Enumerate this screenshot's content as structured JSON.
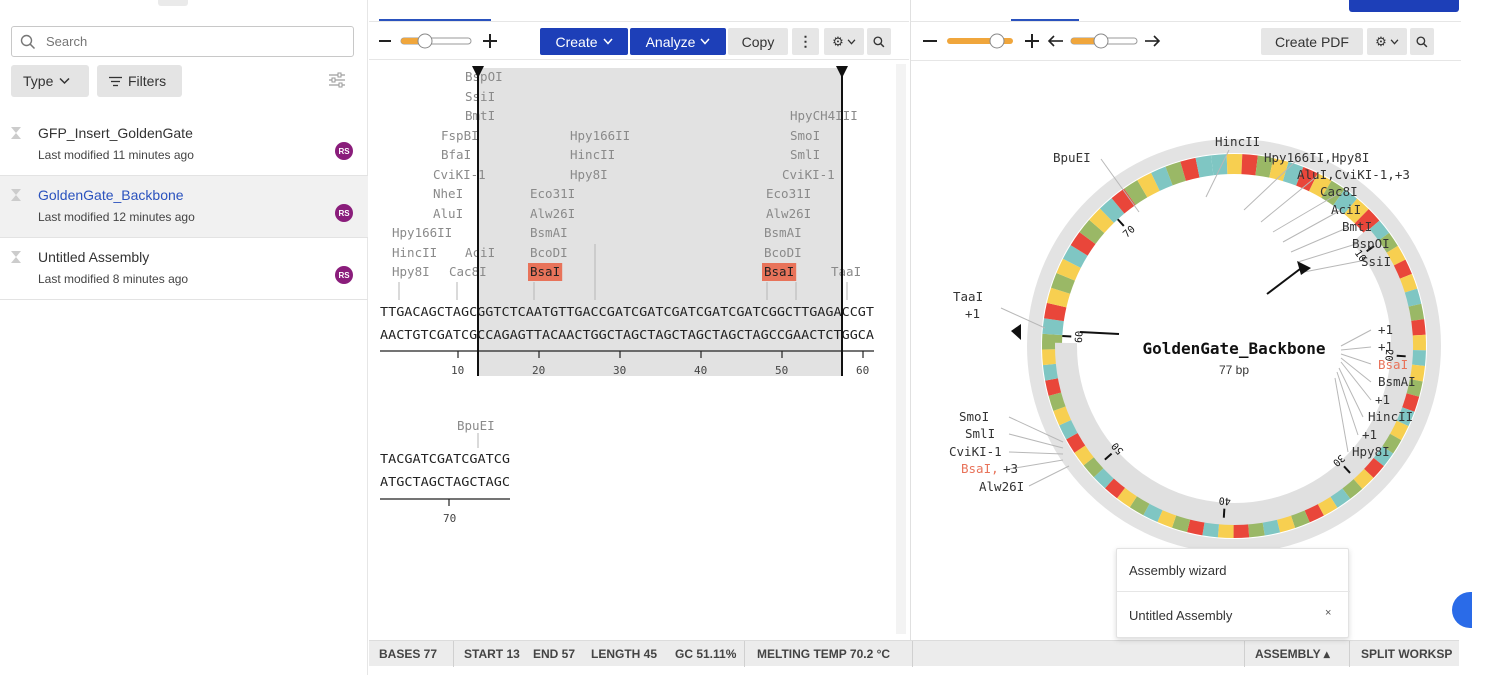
{
  "sidebar": {
    "search_placeholder": "Search",
    "type_label": "Type",
    "filters_label": "Filters",
    "files": [
      {
        "name": "GFP_Insert_GoldenGate",
        "meta": "Last modified 11 minutes ago",
        "avatar": "RS"
      },
      {
        "name": "GoldenGate_Backbone",
        "meta": "Last modified 12 minutes ago",
        "avatar": "RS"
      },
      {
        "name": "Untitled Assembly",
        "meta": "Last modified 8 minutes ago",
        "avatar": "RS"
      }
    ]
  },
  "seq_toolbar": {
    "create_label": "Create",
    "analyze_label": "Analyze",
    "copy_label": "Copy",
    "more_label": "⋮"
  },
  "sequence": {
    "row1_top": "TTGACAGCTAGCGGTCTCAATGTTGACCGATCGATCGATCGATCGATCGGCTTGAGACCGT",
    "row1_bottom": "AACTGTCGATCGCCAGAGTTACAACTGGCTAGCTAGCTAGCTAGCTAGCCGAACTCTGGCA",
    "row1_ticks": [
      "10",
      "20",
      "30",
      "40",
      "50",
      "60"
    ],
    "row2_top": "TACGATCGATCGATCG",
    "row2_bottom": "ATGCTAGCTAGCTAGC",
    "row2_ticks": [
      "70"
    ],
    "row2_enzyme": "BpuEI",
    "enzyme_labels": [
      {
        "name": "BspOI",
        "highlight": false
      },
      {
        "name": "SsiI",
        "highlight": false
      },
      {
        "name": "BmtI",
        "highlight": false
      },
      {
        "name": "FspBI",
        "highlight": false
      },
      {
        "name": "BfaI",
        "highlight": false
      },
      {
        "name": "CviKI-1",
        "highlight": false
      },
      {
        "name": "NheI",
        "highlight": false
      },
      {
        "name": "AluI",
        "highlight": false
      },
      {
        "name": "Hpy166II",
        "highlight": false
      },
      {
        "name": "HincII",
        "highlight": false
      },
      {
        "name": "Hpy8I",
        "highlight": false
      },
      {
        "name": "AciI",
        "highlight": false
      },
      {
        "name": "Cac8I",
        "highlight": false
      },
      {
        "name": "Hpy166II",
        "highlight": false
      },
      {
        "name": "HincII",
        "highlight": false
      },
      {
        "name": "Hpy8I",
        "highlight": false
      },
      {
        "name": "Eco31I",
        "highlight": false
      },
      {
        "name": "Alw26I",
        "highlight": false
      },
      {
        "name": "BsmAI",
        "highlight": false
      },
      {
        "name": "BcoDI",
        "highlight": false
      },
      {
        "name": "BsaI",
        "highlight": true
      },
      {
        "name": "HpyCH4III",
        "highlight": false
      },
      {
        "name": "SmoI",
        "highlight": false
      },
      {
        "name": "SmlI",
        "highlight": false
      },
      {
        "name": "CviKI-1",
        "highlight": false
      },
      {
        "name": "Eco31I",
        "highlight": false
      },
      {
        "name": "Alw26I",
        "highlight": false
      },
      {
        "name": "BsmAI",
        "highlight": false
      },
      {
        "name": "BcoDI",
        "highlight": false
      },
      {
        "name": "BsaI",
        "highlight": true
      },
      {
        "name": "TaaI",
        "highlight": false
      }
    ]
  },
  "map_toolbar": {
    "create_pdf_label": "Create PDF"
  },
  "plasmid": {
    "name": "GoldenGate_Backbone",
    "length": "77 bp",
    "ticks": [
      "10",
      "20",
      "30",
      "40",
      "50",
      "60",
      "70"
    ],
    "labels": {
      "bpuei": "BpuEI",
      "hincii_top": "HincII",
      "hpy166ii_hpy8i": "Hpy166II,Hpy8I",
      "alui_group": "AluI,CviKI-1,+3",
      "cac8i": "Cac8I",
      "acii": "AciI",
      "bmti": "BmtI",
      "bspoi": "BspOI",
      "ssii": "SsiI",
      "taai": "TaaI",
      "taai_more": "+1",
      "r_plus1_a": "+1",
      "r_plus1_b": "+1",
      "r_bsai": "BsaI",
      "r_bsmai": "BsmAI",
      "r_plus1_c": "+1",
      "r_hincii": "HincII",
      "r_plus1_d": "+1",
      "r_hpy8i": "Hpy8I",
      "smoi": "SmoI",
      "smli": "SmlI",
      "cviki": "CviKI-1",
      "bsai_left": "BsaI,",
      "bsai_left_more": "+3",
      "alw26i": "Alw26I"
    },
    "colors": {
      "highlight": "#e8735a",
      "segments": [
        "#e9463a",
        "#7fc6c3",
        "#f7cf50",
        "#9ab866"
      ]
    }
  },
  "statusbar": {
    "bases": "BASES 77",
    "start": "START 13",
    "end": "END 57",
    "length": "LENGTH 45",
    "gc": "GC 51.11%",
    "melting": "MELTING TEMP 70.2 °C",
    "assembly": "ASSEMBLY ▴",
    "split": "SPLIT WORKSP"
  },
  "popup": {
    "wizard": "Assembly wizard",
    "item": "Untitled Assembly",
    "close": "×"
  }
}
